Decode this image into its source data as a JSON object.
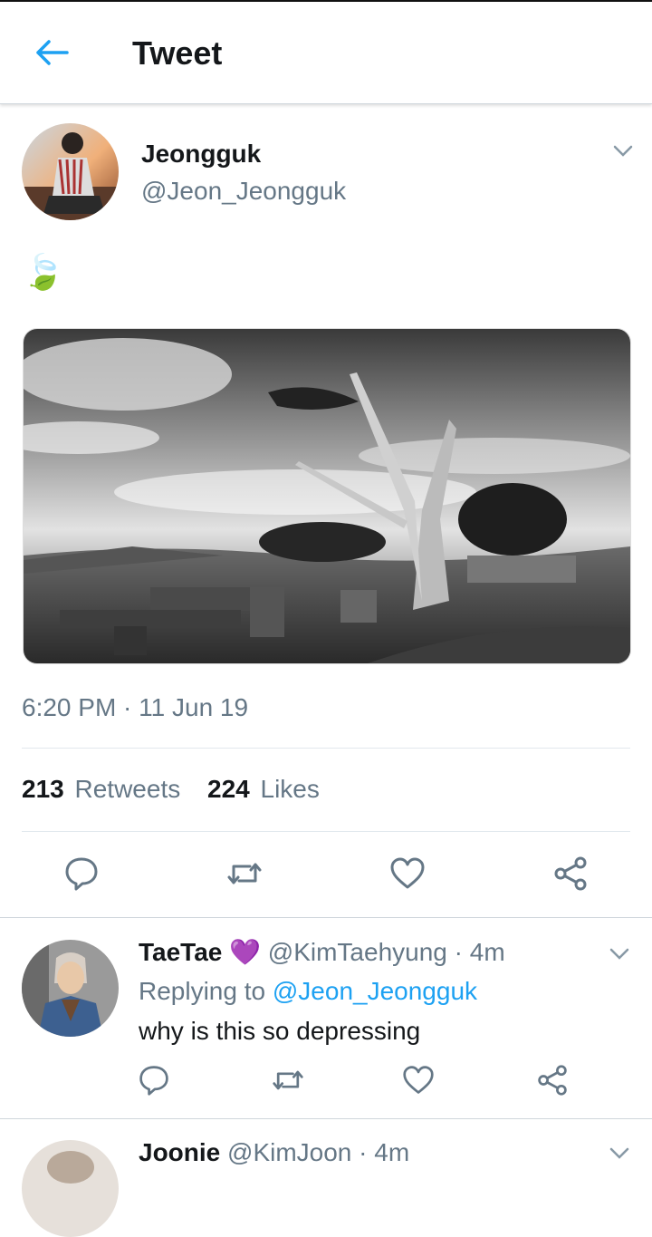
{
  "header": {
    "title": "Tweet",
    "back_icon": "arrow-left-icon",
    "accent": "#1da1f2"
  },
  "tweet": {
    "author_name": "Jeongguk",
    "handle": "@Jeon_Jeongguk",
    "text_emoji": "🍃",
    "timestamp": "6:20 PM · 11 Jun 19",
    "retweets_count": "213",
    "retweets_label": "Retweets",
    "likes_count": "224",
    "likes_label": "Likes",
    "image": "black-and-white-landscape-dead-tree-photo"
  },
  "actions": [
    "reply-icon",
    "retweet-icon",
    "like-icon",
    "share-icon"
  ],
  "replies": [
    {
      "name": "TaeTae",
      "emoji": "💜",
      "handle": "@KimTaehyung",
      "time": "· 4m",
      "replying_prefix": "Replying to",
      "replying_to": "@Jeon_Jeongguk",
      "text": "why is this so depressing"
    },
    {
      "name": "Joonie",
      "handle": "@KimJoon",
      "time": "· 4m"
    }
  ]
}
